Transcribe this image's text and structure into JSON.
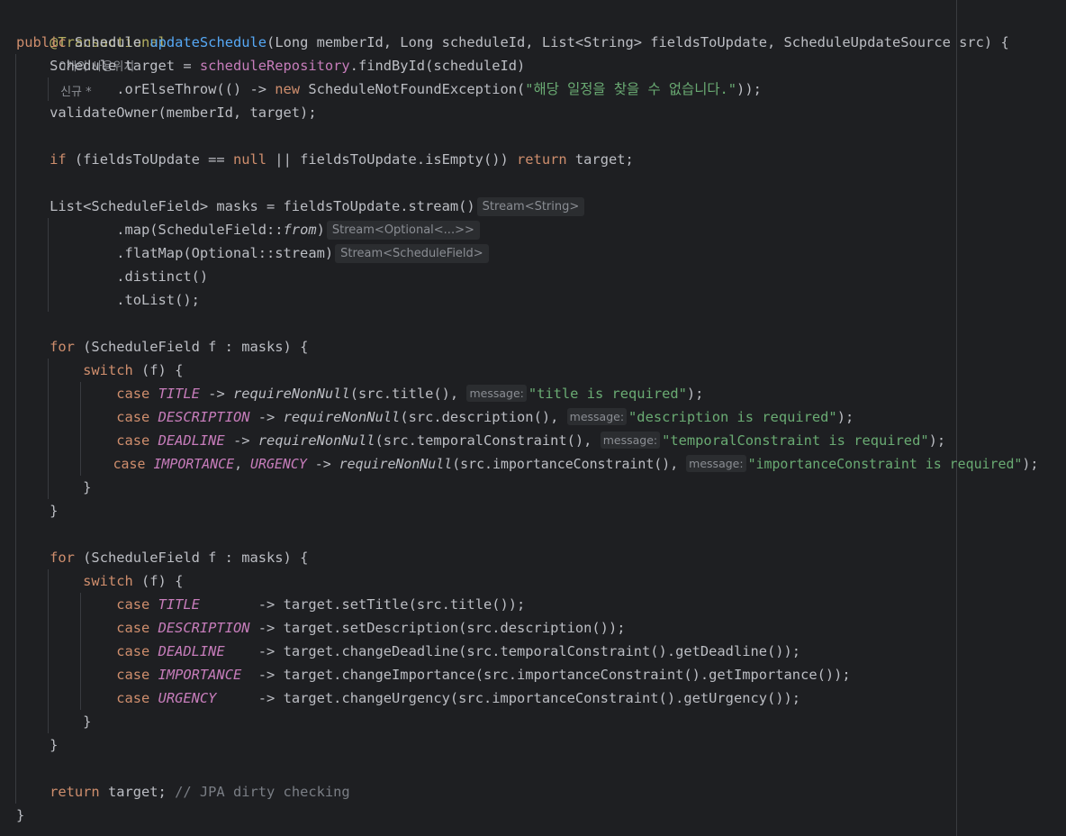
{
  "header": {
    "annotation": "@Transactional",
    "usages": "0개의 사용위치",
    "author": "신규 *"
  },
  "code": {
    "l1_public": "public",
    "l1_type": "Schedule",
    "l1_method": "updateSchedule",
    "l1_sig": "(Long memberId, Long scheduleId, List<String> fieldsToUpdate, ScheduleUpdateSource src) {",
    "l2_a": "Schedule target = ",
    "l2_field": "scheduleRepository",
    "l2_b": ".findById(scheduleId)",
    "l3_a": ".orElseThrow(() -> ",
    "l3_new": "new",
    "l3_b": " ScheduleNotFoundException(",
    "l3_str": "\"해당 일정을 찾을 수 없습니다.\"",
    "l3_c": "));",
    "l4": "validateOwner(memberId, target);",
    "l5_if": "if",
    "l5_a": " (fieldsToUpdate == ",
    "l5_null": "null",
    "l5_b": " || fieldsToUpdate.isEmpty()) ",
    "l5_return": "return",
    "l5_c": " target;",
    "l6": "List<ScheduleField> masks = fieldsToUpdate.stream()",
    "l6_hint": "Stream<String>",
    "l7_a": ".map(ScheduleField::",
    "l7_from": "from",
    "l7_b": ")",
    "l7_hint": "Stream<Optional<...>>",
    "l8": ".flatMap(Optional::stream)",
    "l8_hint": "Stream<ScheduleField>",
    "l9": ".distinct()",
    "l10": ".toList();",
    "for_kw": "for",
    "for_rest": " (ScheduleField f : masks) {",
    "switch_kw": "switch",
    "switch_rest": " (f) {",
    "case_kw": "case",
    "arrow": " -> ",
    "req": "requireNonNull",
    "param_hint": "message:",
    "c1_enum": "TITLE",
    "c1_arg": "(src.title(), ",
    "c1_str": "\"title is required\"",
    "c2_enum": "DESCRIPTION",
    "c2_arg": "(src.description(), ",
    "c2_str": "\"description is required\"",
    "c3_enum": "DEADLINE",
    "c3_arg": "(src.temporalConstraint(), ",
    "c3_str": "\"temporalConstraint is required\"",
    "c4_enum1": "IMPORTANCE",
    "c4_comma": ", ",
    "c4_enum2": "URGENCY",
    "c4_arg": "(src.importanceConstraint(), ",
    "c4_str": "\"importanceConstraint is required\"",
    "close_paren": ");",
    "brace_close": "}",
    "d1_enum": "TITLE",
    "d1_pad": "       ",
    "d1_rest": "-> target.setTitle(src.title());",
    "d2_enum": "DESCRIPTION",
    "d2_pad": " ",
    "d2_rest": "-> target.setDescription(src.description());",
    "d3_enum": "DEADLINE",
    "d3_pad": "    ",
    "d3_rest": "-> target.changeDeadline(src.temporalConstraint().getDeadline());",
    "d4_enum": "IMPORTANCE",
    "d4_pad": "  ",
    "d4_rest": "-> target.changeImportance(src.importanceConstraint().getImportance());",
    "d5_enum": "URGENCY",
    "d5_pad": "     ",
    "d5_rest": "-> target.changeUrgency(src.importanceConstraint().getUrgency());",
    "ret_kw": "return",
    "ret_rest": " target; ",
    "ret_cmt": "// JPA dirty checking"
  },
  "colors": {
    "background": "#1e1f22",
    "keyword": "#cf8e6d",
    "string": "#6aab73",
    "field": "#c77dbb",
    "annotation": "#b3ae60",
    "comment": "#7a7e85"
  }
}
